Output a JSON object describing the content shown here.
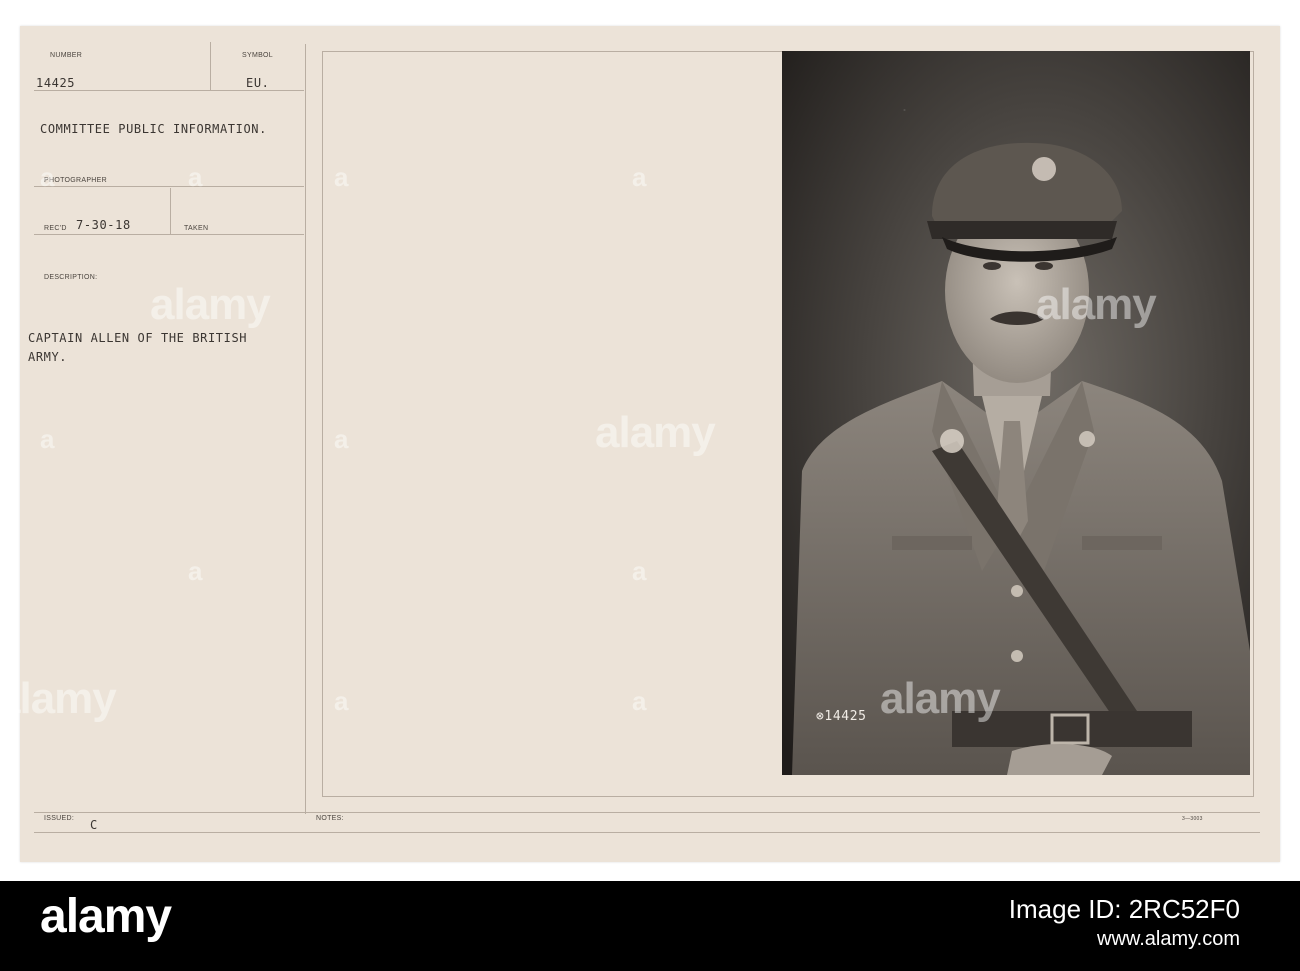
{
  "record": {
    "number_label": "NUMBER",
    "number_value": "14425",
    "symbol_label": "SYMBOL",
    "symbol_value": "EU.",
    "source": "COMMITTEE PUBLIC INFORMATION.",
    "photographer_label": "PHOTOGRAPHER",
    "recd_label": "REC'D",
    "recd_value": "7-30-18",
    "taken_label": "TAKEN",
    "description_label": "DESCRIPTION:",
    "description_line1": "CAPTAIN ALLEN OF THE BRITISH",
    "description_line2": "ARMY.",
    "issued_label": "ISSUED:",
    "issued_value": "C",
    "notes_label": "NOTES:",
    "form_code": "3—3003"
  },
  "photo": {
    "stamp": "⊗14425"
  },
  "watermark": {
    "text": "alamy",
    "letter": "a"
  },
  "footer": {
    "brand": "alamy",
    "image_id_label": "Image ID: 2RC52F0",
    "site": "www.alamy.com"
  }
}
